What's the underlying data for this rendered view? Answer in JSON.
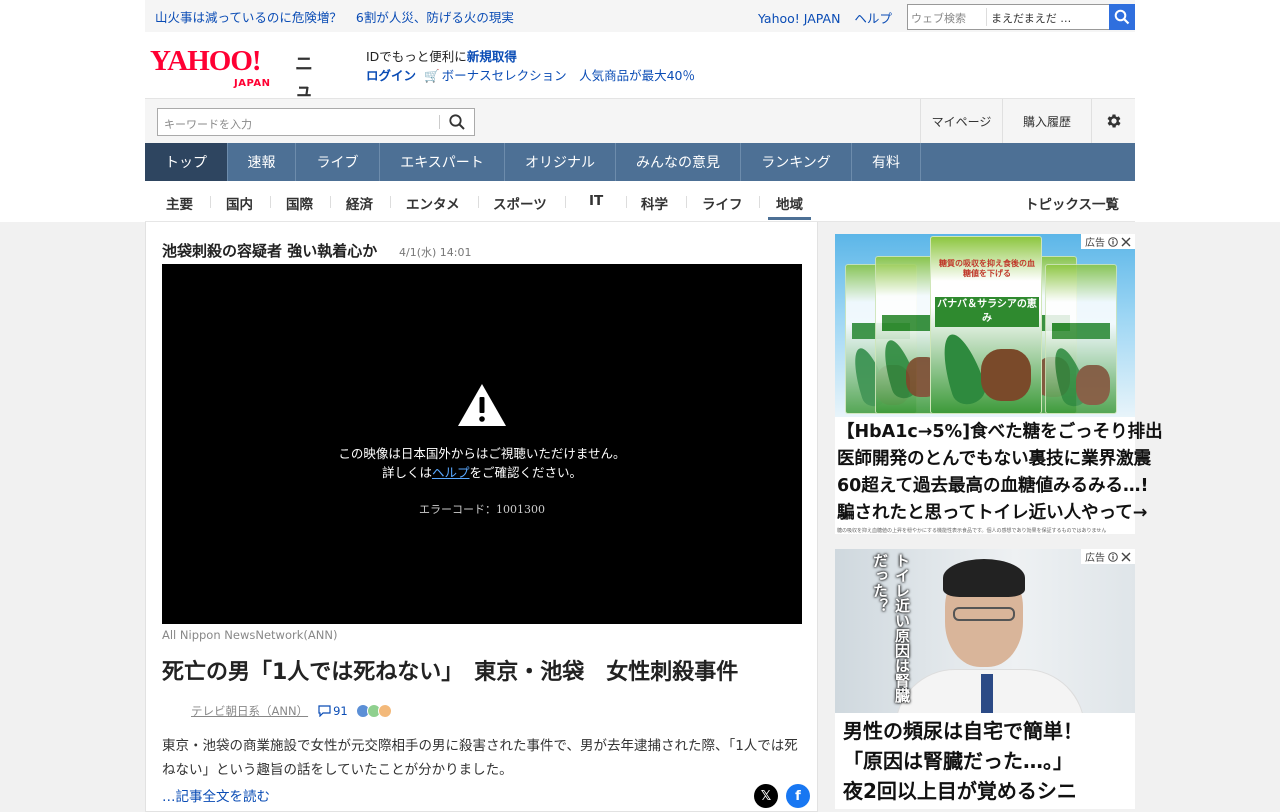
{
  "topbar": {
    "headline_a": "山火事は減っているのに危険増？",
    "headline_b": "6割が人災、防げる火の現実",
    "link_yahoo": "Yahoo! JAPAN",
    "link_help": "ヘルプ",
    "web_search_placeholder": "ウェブ検索",
    "web_search_trend": "まえだまえだ …"
  },
  "header": {
    "logo_main": "YAHOO!",
    "logo_sub": "JAPAN",
    "logo_news": "ニュース",
    "promo_prefix": "IDでもっと便利に",
    "promo_register": "新規取得",
    "promo_login": "ログイン",
    "promo_text": "ボーナスセレクション　人気商品が最大40％"
  },
  "search": {
    "placeholder": "キーワードを入力",
    "mypage": "マイページ",
    "history": "購入履歴"
  },
  "main_nav": [
    "トップ",
    "速報",
    "ライブ",
    "エキスパート",
    "オリジナル",
    "みんなの意見",
    "ランキング",
    "有料"
  ],
  "sub_nav": [
    "主要",
    "国内",
    "国際",
    "経済",
    "エンタメ",
    "スポーツ",
    "IT",
    "科学",
    "ライフ",
    "地域"
  ],
  "sub_nav_right": "トピックス一覧",
  "article": {
    "video_title": "池袋刺殺の容疑者 強い執着心か",
    "video_date": "4/1(水) 14:01",
    "video_msg_1": "この映像は日本国外からはご視聴いただけません。",
    "video_msg_2_pre": "詳しくは",
    "video_msg_2_link": "ヘルプ",
    "video_msg_2_post": "をご確認ください。",
    "video_error": "エラーコード：1001300",
    "credit": "All Nippon NewsNetwork(ANN)",
    "headline": "死亡の男「1人では死ねない」　東京・池袋　女性刺殺事件",
    "source": "テレビ朝日系（ANN）",
    "comments": "91",
    "body": "東京・池袋の商業施設で女性が元交際相手の男に殺害された事件で、男が去年逮捕された際、「1人では死ねない」という趣旨の話をしていたことが分かりました。",
    "read_more": "…記事全文を読む"
  },
  "ads": {
    "label": "広告",
    "ad1_lines": [
      "【HbA1c→5%]食べた糖をごっそり排出",
      "医師開発のとんでもない裏技に業界激震",
      "60超えて過去最高の血糖値みるみる…!",
      "騙されたと思ってトイレ近い人やって→"
    ],
    "ad1_fine": "糖の吸収を抑え血糖値の上昇を穏やかにする機能性表示食品です。個人の感想であり効果を保証するものではありません",
    "ad1_pkg_top": "糖質の吸収を抑え食後の血糖値を下げる",
    "ad1_pkg_name": "バナバ＆サラシアの恵み",
    "ad2_vertical": "トイレ近い原因は腎臓だった？",
    "ad2_lines": [
      "男性の頻尿は自宅で簡単！",
      "「原因は腎臓だった…。」",
      "夜2回以上目が覚めるシニ"
    ]
  },
  "colors": {
    "brand_red": "#ff0033",
    "nav_blue": "#4d7095",
    "nav_active": "#2e4560",
    "link_blue": "#0a4cb5"
  }
}
